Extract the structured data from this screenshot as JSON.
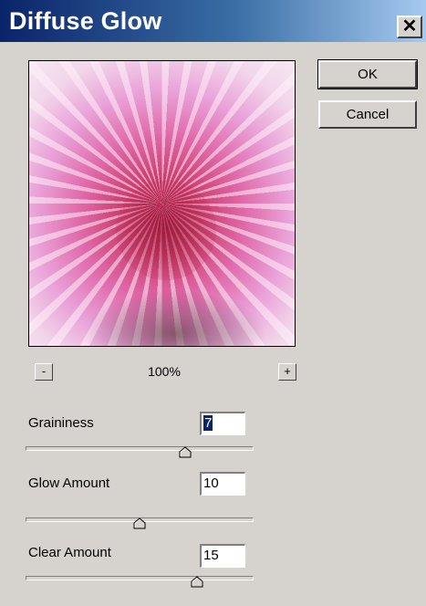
{
  "dialog": {
    "title": "Diffuse Glow",
    "close_label": "✕"
  },
  "buttons": {
    "ok_label": "OK",
    "cancel_label": "Cancel"
  },
  "preview": {
    "zoom_out_label": "-",
    "zoom_in_label": "+",
    "zoom_level": "100%"
  },
  "controls": {
    "graininess": {
      "label": "Graininess",
      "value": "7",
      "slider_fraction": 0.7
    },
    "glow_amount": {
      "label": "Glow Amount",
      "value": "10",
      "slider_fraction": 0.5
    },
    "clear_amount": {
      "label": "Clear Amount",
      "value": "15",
      "slider_fraction": 0.75
    }
  },
  "colors": {
    "titlebar_start": "#0a246a",
    "titlebar_end": "#a6caf0",
    "dialog_bg": "#d6d3ce",
    "selection": "#0a246a"
  },
  "icons": {
    "close": "close-icon",
    "zoom_out": "minus-icon",
    "zoom_in": "plus-icon",
    "slider_thumb": "slider-thumb-icon"
  }
}
